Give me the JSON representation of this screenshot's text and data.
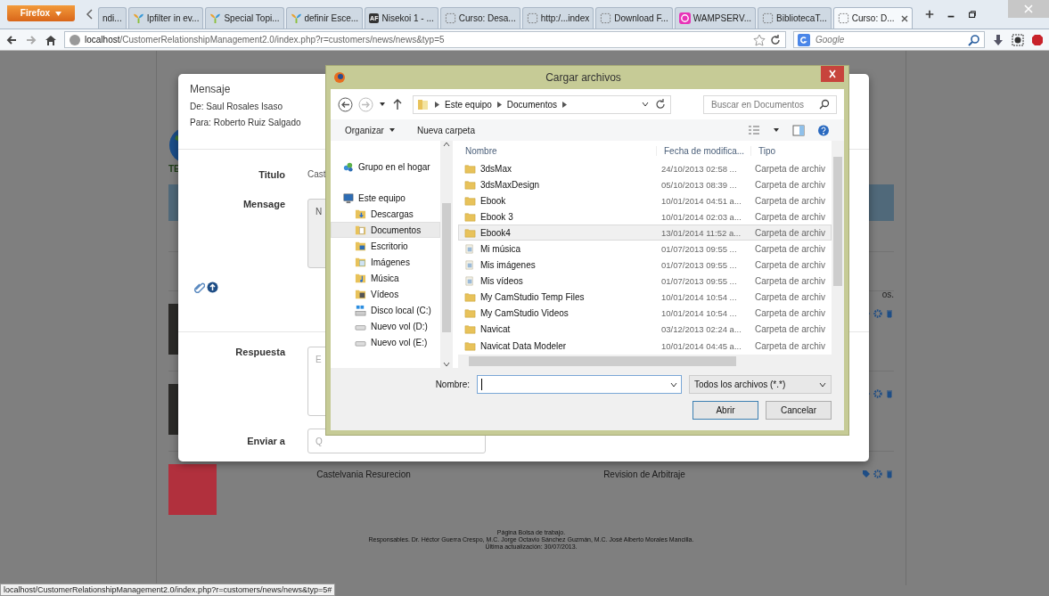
{
  "browser": {
    "menu_button": "Firefox",
    "tabs": [
      {
        "title": "ndi...",
        "kind": "none",
        "selected": false
      },
      {
        "title": "Ipfilter in ev...",
        "kind": "leaf",
        "selected": false
      },
      {
        "title": "Special Topi...",
        "kind": "leaf",
        "selected": false
      },
      {
        "title": "definir Esce...",
        "kind": "leaf",
        "selected": false
      },
      {
        "title": "Nisekoi 1 - ...",
        "kind": "badge",
        "badge": "AF",
        "selected": false
      },
      {
        "title": "Curso: Desa...",
        "kind": "blank",
        "selected": false
      },
      {
        "title": "http:/...index",
        "kind": "blank",
        "selected": false
      },
      {
        "title": "Download F...",
        "kind": "blank",
        "selected": false
      },
      {
        "title": "WAMPSERV...",
        "kind": "wamp",
        "selected": false
      },
      {
        "title": "BibliotecaT...",
        "kind": "blank",
        "selected": false
      },
      {
        "title": "Curso: D...",
        "kind": "blank",
        "selected": true
      }
    ],
    "url": "**localhost**/CustomerRelationshipManagement2.0/index.php?r=customers/news/news&typ=5",
    "search_placeholder": "Google",
    "status_url": "localhost/CustomerRelationshipManagement2.0/index.php?r=customers/news/news&typ=5#"
  },
  "page": {
    "logo_text": "TE",
    "heading_note": "os.",
    "rows": [
      {
        "kind": "dark"
      },
      {
        "kind": "dark"
      },
      {
        "title": "Castelvania Resurecion",
        "category": "Revision de Arbitraje",
        "kind": "red"
      }
    ],
    "footer": [
      "Página Bolsa de trabajo.",
      "Responsables. Dr. Héctor Guerra Crespo, M.C. Jorge Octavio Sánchez Guzmán, M.C. José Alberto Morales Mancilla.",
      "Última actualización: 30/07/2013."
    ]
  },
  "modal": {
    "title": "Mensaje",
    "from": "De: Saul Rosales Isaso",
    "to": "Para: Roberto Ruiz Salgado",
    "fields": [
      {
        "label": "Titulo",
        "kind": "text",
        "value": "Cast"
      },
      {
        "label": "Mensage",
        "kind": "message",
        "value": "N"
      },
      {
        "kind": "attachments"
      },
      {
        "label": "Respuesta",
        "kind": "textarea",
        "placeholder": "E"
      },
      {
        "label": "Enviar a",
        "kind": "input",
        "placeholder": "Q"
      }
    ]
  },
  "dialog": {
    "title": "Cargar archivos",
    "breadcrumb": [
      "Este equipo",
      "Documentos"
    ],
    "search_placeholder": "Buscar en Documentos",
    "toolbar": [
      "Organizar",
      "Nueva carpeta"
    ],
    "nav": [
      {
        "label": "Grupo en el hogar",
        "kind": "homegroup",
        "selected": false
      },
      {
        "label": "Este equipo",
        "kind": "computer",
        "selected": false,
        "children": [
          {
            "label": "Descargas",
            "kind": "downloads",
            "selected": false
          },
          {
            "label": "Documentos",
            "kind": "documents",
            "selected": true
          },
          {
            "label": "Escritorio",
            "kind": "desktop",
            "selected": false
          },
          {
            "label": "Imágenes",
            "kind": "pictures",
            "selected": false
          },
          {
            "label": "Música",
            "kind": "music",
            "selected": false
          },
          {
            "label": "Vídeos",
            "kind": "videos",
            "selected": false
          },
          {
            "label": "Disco local (C:)",
            "kind": "system-drive",
            "selected": false
          },
          {
            "label": "Nuevo vol (D:)",
            "kind": "drive",
            "selected": false
          },
          {
            "label": "Nuevo vol (E:)",
            "kind": "drive",
            "selected": false
          }
        ]
      }
    ],
    "columns": [
      "Nombre",
      "Fecha de modifica...",
      "Tipo"
    ],
    "files": [
      {
        "name": "3dsMax",
        "date": "24/10/2013 02:58 ...",
        "type": "Carpeta de archiv",
        "kind": "folder",
        "selected": false
      },
      {
        "name": "3dsMaxDesign",
        "date": "05/10/2013 08:39 ...",
        "type": "Carpeta de archiv",
        "kind": "folder",
        "selected": false
      },
      {
        "name": "Ebook",
        "date": "10/01/2014 04:51 a...",
        "type": "Carpeta de archiv",
        "kind": "folder",
        "selected": false
      },
      {
        "name": "Ebook 3",
        "date": "10/01/2014 02:03 a...",
        "type": "Carpeta de archiv",
        "kind": "folder",
        "selected": false
      },
      {
        "name": "Ebook4",
        "date": "13/01/2014 11:52 a...",
        "type": "Carpeta de archiv",
        "kind": "folder",
        "selected": true
      },
      {
        "name": "Mi música",
        "date": "01/07/2013 09:55 ...",
        "type": "Carpeta de archiv",
        "kind": "library",
        "selected": false
      },
      {
        "name": "Mis imágenes",
        "date": "01/07/2013 09:55 ...",
        "type": "Carpeta de archiv",
        "kind": "library",
        "selected": false
      },
      {
        "name": "Mis vídeos",
        "date": "01/07/2013 09:55 ...",
        "type": "Carpeta de archiv",
        "kind": "library",
        "selected": false
      },
      {
        "name": "My CamStudio Temp Files",
        "date": "10/01/2014 10:54 ...",
        "type": "Carpeta de archiv",
        "kind": "folder",
        "selected": false
      },
      {
        "name": "My CamStudio Videos",
        "date": "10/01/2014 10:54 ...",
        "type": "Carpeta de archiv",
        "kind": "folder",
        "selected": false
      },
      {
        "name": "Navicat",
        "date": "03/12/2013 02:24 a...",
        "type": "Carpeta de archiv",
        "kind": "folder",
        "selected": false
      },
      {
        "name": "Navicat Data Modeler",
        "date": "10/01/2014 04:45 a...",
        "type": "Carpeta de archiv",
        "kind": "folder",
        "selected": false
      }
    ],
    "name_label": "Nombre:",
    "filter": "Todos los archivos (*.*)",
    "buttons": [
      "Abrir",
      "Cancelar"
    ]
  }
}
